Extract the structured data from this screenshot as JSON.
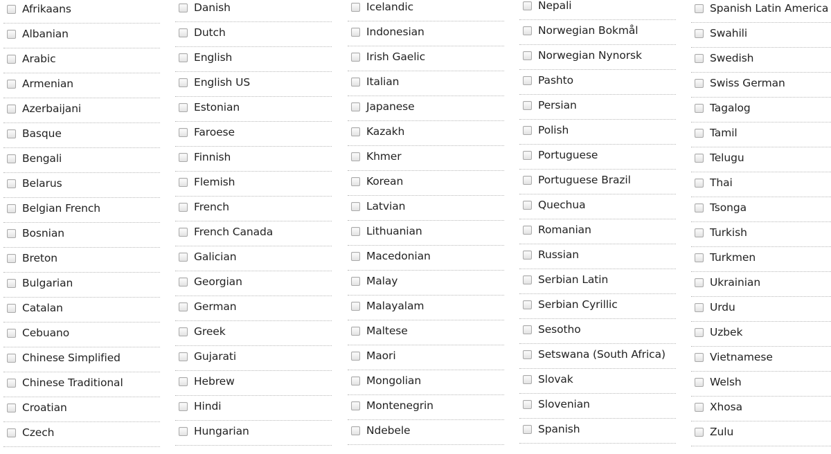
{
  "languages": {
    "columns": [
      [
        "Afrikaans",
        "Albanian",
        "Arabic",
        "Armenian",
        "Azerbaijani",
        "Basque",
        "Bengali",
        "Belarus",
        "Belgian French",
        "Bosnian",
        "Breton",
        "Bulgarian",
        "Catalan",
        "Cebuano",
        "Chinese Simplified",
        "Chinese Traditional",
        "Croatian",
        "Czech"
      ],
      [
        "Danish",
        "Dutch",
        "English",
        "English US",
        "Estonian",
        "Faroese",
        "Finnish",
        "Flemish",
        "French",
        "French Canada",
        "Galician",
        "Georgian",
        "German",
        "Greek",
        "Gujarati",
        "Hebrew",
        "Hindi",
        "Hungarian"
      ],
      [
        "Icelandic",
        "Indonesian",
        "Irish Gaelic",
        "Italian",
        "Japanese",
        "Kazakh",
        "Khmer",
        "Korean",
        "Latvian",
        "Lithuanian",
        "Macedonian",
        "Malay",
        "Malayalam",
        "Maltese",
        "Maori",
        "Mongolian",
        "Montenegrin",
        "Ndebele"
      ],
      [
        "Nepali",
        "Norwegian Bokmål",
        "Norwegian Nynorsk",
        "Pashto",
        "Persian",
        "Polish",
        "Portuguese",
        "Portuguese Brazil",
        "Quechua",
        "Romanian",
        "Russian",
        "Serbian Latin",
        "Serbian Cyrillic",
        "Sesotho",
        "Setswana (South Africa)",
        "Slovak",
        "Slovenian",
        "Spanish"
      ],
      [
        "Spanish Latin America",
        "Swahili",
        "Swedish",
        "Swiss German",
        "Tagalog",
        "Tamil",
        "Telugu",
        "Thai",
        "Tsonga",
        "Turkish",
        "Turkmen",
        "Ukrainian",
        "Urdu",
        "Uzbek",
        "Vietnamese",
        "Welsh",
        "Xhosa",
        "Zulu"
      ]
    ],
    "checked": false
  }
}
